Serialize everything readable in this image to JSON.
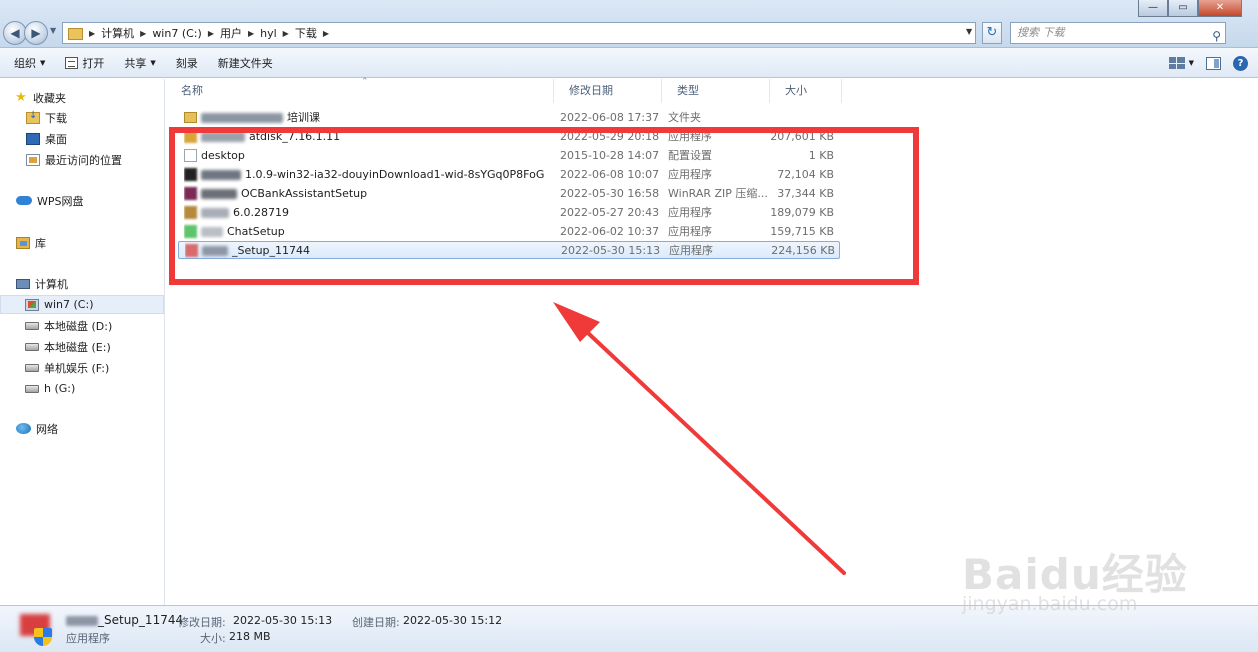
{
  "window": {
    "breadcrumbs": [
      "计算机",
      "win7 (C:)",
      "用户",
      "hyl",
      "下载"
    ],
    "search_placeholder": "搜索 下载",
    "buttons": {
      "minimize": "—",
      "maximize": "▭",
      "close": "✕"
    }
  },
  "toolbar": {
    "organize": "组织",
    "open": "打开",
    "share": "共享",
    "burn": "刻录",
    "new_folder": "新建文件夹"
  },
  "sidebar": {
    "favorites": "收藏夹",
    "downloads": "下载",
    "desktop": "桌面",
    "recent": "最近访问的位置",
    "wps": "WPS网盘",
    "library": "库",
    "computer": "计算机",
    "drives": [
      "win7 (C:)",
      "本地磁盘 (D:)",
      "本地磁盘 (E:)",
      "单机娱乐 (F:)",
      "h (G:)"
    ],
    "network": "网络"
  },
  "columns": {
    "name": "名称",
    "date": "修改日期",
    "type": "类型",
    "size": "大小"
  },
  "files": [
    {
      "name": "培训课",
      "date": "2022-06-08 17:37",
      "type": "文件夹",
      "size": "",
      "icon": "folder-icon"
    },
    {
      "name": "atdisk_7.16.1.11",
      "date": "2022-05-29 20:18",
      "type": "应用程序",
      "size": "207,601 KB",
      "icon": "exe-icon"
    },
    {
      "name": "desktop",
      "date": "2015-10-28 14:07",
      "type": "配置设置",
      "size": "1 KB",
      "icon": "config-file-icon"
    },
    {
      "name": "1.0.9-win32-ia32-douyinDownload1-wid-8sYGq0P8FoG",
      "date": "2022-06-08 10:07",
      "type": "应用程序",
      "size": "72,104 KB",
      "icon": "exe-icon"
    },
    {
      "name": "OCBankAssistantSetup",
      "date": "2022-05-30 16:58",
      "type": "WinRAR ZIP 压缩...",
      "size": "37,344 KB",
      "icon": "archive-icon"
    },
    {
      "name": "6.0.28719",
      "date": "2022-05-27 20:43",
      "type": "应用程序",
      "size": "189,079 KB",
      "icon": "exe-icon"
    },
    {
      "name": "ChatSetup",
      "date": "2022-06-02 10:37",
      "type": "应用程序",
      "size": "159,715 KB",
      "icon": "exe-icon"
    },
    {
      "name": "_Setup_11744",
      "date": "2022-05-30 15:13",
      "type": "应用程序",
      "size": "224,156 KB",
      "icon": "exe-icon"
    }
  ],
  "details": {
    "name": "_Setup_11744",
    "type": "应用程序",
    "modified_label": "修改日期:",
    "modified": "2022-05-30 15:13",
    "size_label": "大小:",
    "size": "218 MB",
    "created_label": "创建日期:",
    "created": "2022-05-30 15:12"
  },
  "watermark": {
    "main": "Baidu经验",
    "sub": "jingyan.baidu.com"
  },
  "colors": {
    "annotation": "#f03a3a",
    "selection": "#dbeafc",
    "chrome": "#dce8f5"
  }
}
